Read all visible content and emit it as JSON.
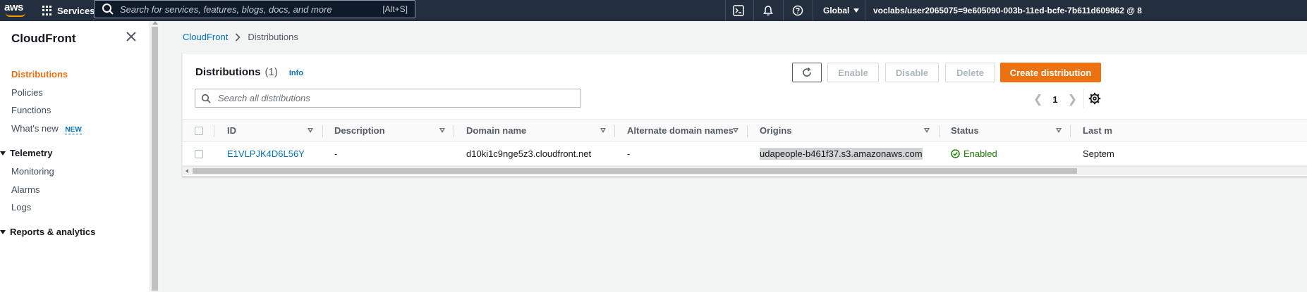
{
  "topnav": {
    "logo_text": "aws",
    "services_label": "Services",
    "search_placeholder": "Search for services, features, blogs, docs, and more",
    "search_shortcut": "[Alt+S]",
    "region_label": "Global",
    "account_label": "voclabs/user2065075=9e605090-003b-11ed-bcfe-7b611d609862 @ 8"
  },
  "sidenav": {
    "title": "CloudFront",
    "items": [
      {
        "label": "Distributions",
        "active": true
      },
      {
        "label": "Policies"
      },
      {
        "label": "Functions"
      },
      {
        "label": "What's new",
        "badge": "NEW"
      }
    ],
    "sections": [
      {
        "label": "Telemetry",
        "items": [
          "Monitoring",
          "Alarms",
          "Logs"
        ]
      },
      {
        "label": "Reports & analytics"
      }
    ]
  },
  "breadcrumb": {
    "root": "CloudFront",
    "current": "Distributions"
  },
  "panel": {
    "title": "Distributions",
    "count": "(1)",
    "info": "Info",
    "buttons": {
      "enable": "Enable",
      "disable": "Disable",
      "delete": "Delete",
      "create": "Create distribution"
    },
    "search_placeholder": "Search all distributions",
    "page_number": "1"
  },
  "table": {
    "columns": [
      "ID",
      "Description",
      "Domain name",
      "Alternate domain names",
      "Origins",
      "Status",
      "Last m"
    ],
    "rows": [
      {
        "id": "E1VLPJK4D6L56Y",
        "description": "-",
        "domain_name": "d10ki1c9nge5z3.cloudfront.net",
        "alternate_domain_names": "-",
        "origins": "udapeople-b461f37.s3.amazonaws.com",
        "status": "Enabled",
        "last_modified": "Septem"
      }
    ]
  },
  "colors": {
    "topnav_bg": "#232f3e",
    "accent_orange": "#ec7211",
    "link_blue": "#0073bb",
    "status_green": "#1d8102"
  }
}
